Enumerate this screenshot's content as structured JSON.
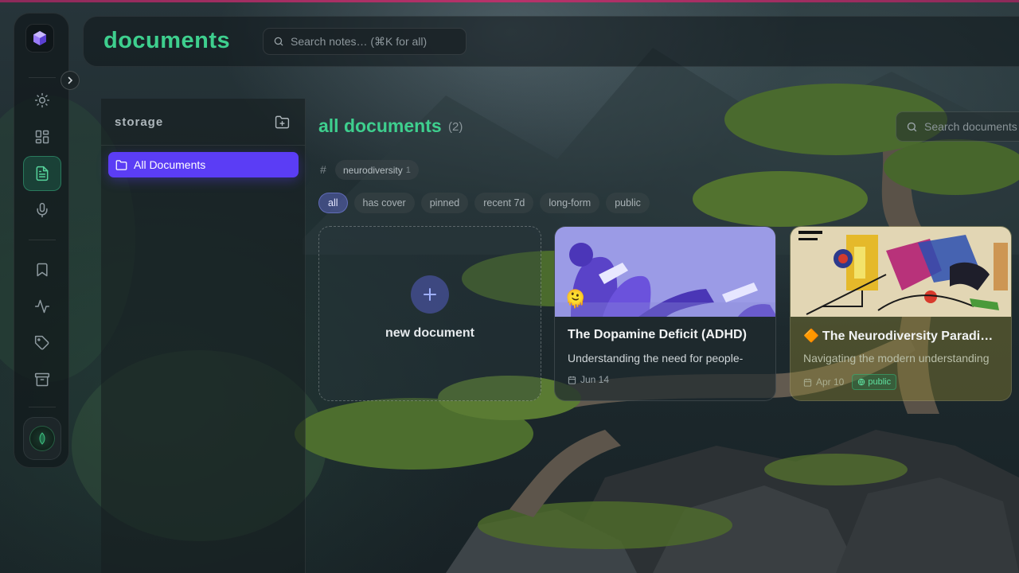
{
  "header": {
    "title": "documents",
    "search_placeholder": "Search notes… (⌘K for all)"
  },
  "rail": {
    "items": [
      {
        "name": "sun",
        "label": ""
      },
      {
        "name": "dashboard",
        "label": ""
      },
      {
        "name": "documents",
        "label": "",
        "active": true
      },
      {
        "name": "microphone",
        "label": ""
      },
      {
        "name": "bookmark",
        "label": ""
      },
      {
        "name": "activity",
        "label": ""
      },
      {
        "name": "tag",
        "label": ""
      },
      {
        "name": "archive",
        "label": ""
      }
    ]
  },
  "storage": {
    "title": "storage",
    "folders": [
      {
        "label": "All Documents",
        "selected": true
      }
    ]
  },
  "documents": {
    "title": "all documents",
    "count": "(2)",
    "search_placeholder": "Search documents",
    "tags": [
      {
        "label": "neurodiversity",
        "count": "1"
      }
    ],
    "filters": [
      "all",
      "has cover",
      "pinned",
      "recent 7d",
      "long-form",
      "public"
    ],
    "active_filter": "all",
    "new_document_label": "new document",
    "cards": [
      {
        "title": "The Dopamine Deficit (ADHD)",
        "emoji": "🫠",
        "excerpt": "Understanding the need for people-",
        "date": "Jun 14",
        "badge": ""
      },
      {
        "title": "The Neurodiversity Paradi…",
        "emoji": "🔶",
        "excerpt": "Navigating the modern understanding",
        "date": "Apr 10",
        "badge": "public"
      }
    ]
  },
  "colors": {
    "accent_green": "#3ecf8e",
    "folder_selected": "#5b3df5",
    "top_bar": "#b8326a"
  }
}
